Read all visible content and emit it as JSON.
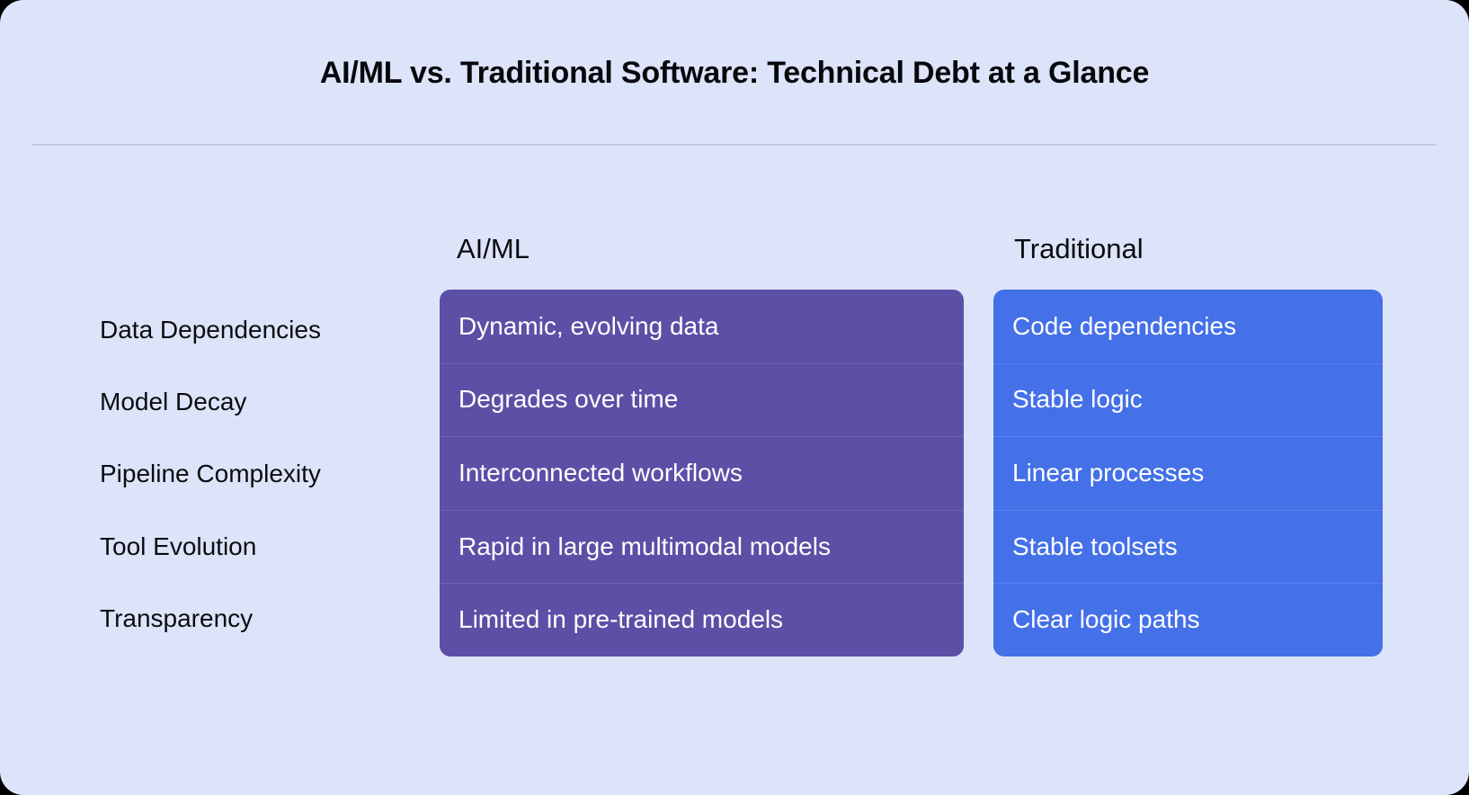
{
  "card": {
    "background_color": "#dde4f9",
    "corner_radius_px": 26
  },
  "header": {
    "title": "AI/ML vs. Traditional Software: Technical Debt at a Glance",
    "divider_color": "#c3cbdf"
  },
  "chart_data": {
    "type": "table",
    "title": "AI/ML vs. Traditional Software: Technical Debt at a Glance",
    "xlabel": "",
    "ylabel": "",
    "legend_position": "none",
    "grid": false,
    "columns": [
      {
        "label": "AI/ML",
        "color": "#5b4fa6"
      },
      {
        "label": "Traditional",
        "color": "#4470e8"
      }
    ],
    "categories": [
      "Data Dependencies",
      "Model Decay",
      "Pipeline Complexity",
      "Tool Evolution",
      "Transparency"
    ],
    "series": [
      {
        "name": "AI/ML",
        "color": "#5b4fa6",
        "values": [
          "Dynamic, evolving data",
          "Degrades over time",
          "Interconnected workflows",
          "Rapid in large multimodal models",
          "Limited in pre-trained models"
        ]
      },
      {
        "name": "Traditional",
        "color": "#4470e8",
        "values": [
          "Code dependencies",
          "Stable logic",
          "Linear processes",
          "Stable toolsets",
          "Clear logic paths"
        ]
      }
    ]
  }
}
